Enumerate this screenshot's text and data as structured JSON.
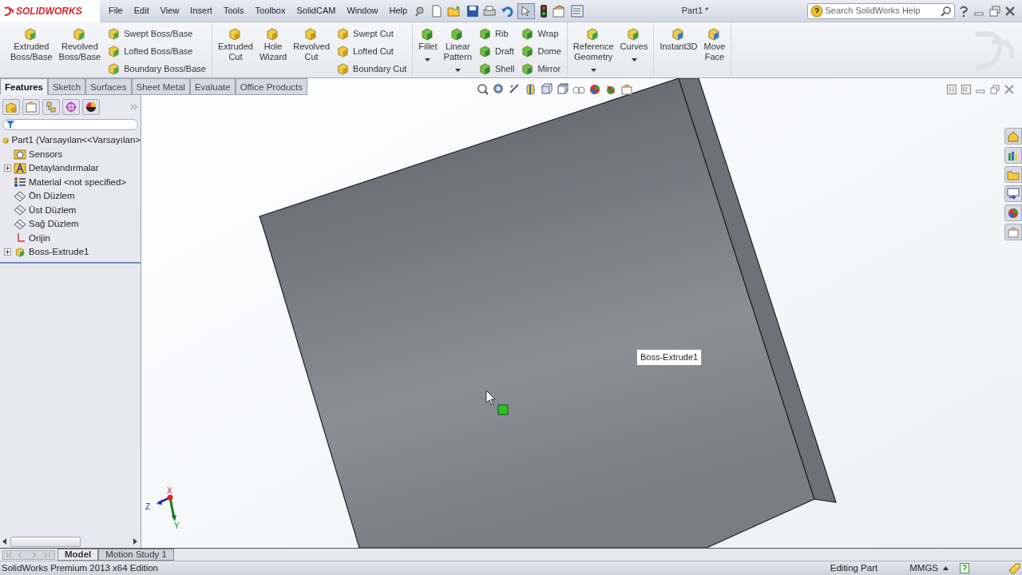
{
  "app": {
    "logo_text": "SOLIDWORKS"
  },
  "menu": [
    "File",
    "Edit",
    "View",
    "Insert",
    "Tools",
    "Toolbox",
    "SolidCAM",
    "Window",
    "Help"
  ],
  "document_title": "Part1 *",
  "search": {
    "placeholder": "Search SolidWorks Help"
  },
  "ribbon": {
    "groups": [
      {
        "columns": [
          {
            "kind": "large",
            "label": "Extruded\nBoss/Base",
            "dropdown": false
          },
          {
            "kind": "large",
            "label": "Revolved\nBoss/Base",
            "dropdown": false
          },
          {
            "kind": "stack",
            "items": [
              "Swept Boss/Base",
              "Lofted Boss/Base",
              "Boundary Boss/Base"
            ]
          }
        ]
      },
      {
        "columns": [
          {
            "kind": "large",
            "label": "Extruded\nCut",
            "dropdown": false
          },
          {
            "kind": "large",
            "label": "Hole\nWizard",
            "dropdown": false
          },
          {
            "kind": "large",
            "label": "Revolved\nCut",
            "dropdown": false
          },
          {
            "kind": "stack",
            "items": [
              "Swept Cut",
              "Lofted Cut",
              "Boundary Cut"
            ]
          }
        ]
      },
      {
        "columns": [
          {
            "kind": "large",
            "label": "Fillet",
            "dropdown": true
          },
          {
            "kind": "large",
            "label": "Linear\nPattern",
            "dropdown": true
          },
          {
            "kind": "stack",
            "items": [
              "Rib",
              "Draft",
              "Shell"
            ]
          },
          {
            "kind": "stack",
            "items": [
              "Wrap",
              "Dome",
              "Mirror"
            ]
          }
        ]
      },
      {
        "columns": [
          {
            "kind": "large",
            "label": "Reference\nGeometry",
            "dropdown": true
          },
          {
            "kind": "large",
            "label": "Curves",
            "dropdown": true
          }
        ]
      },
      {
        "columns": [
          {
            "kind": "large",
            "label": "Instant3D",
            "dropdown": false
          },
          {
            "kind": "large",
            "label": "Move\nFace",
            "dropdown": false
          }
        ]
      }
    ]
  },
  "tabs": [
    {
      "label": "Features",
      "selected": true
    },
    {
      "label": "Sketch",
      "selected": false
    },
    {
      "label": "Surfaces",
      "selected": false
    },
    {
      "label": "Sheet Metal",
      "selected": false
    },
    {
      "label": "Evaluate",
      "selected": false
    },
    {
      "label": "Office Products",
      "selected": false
    }
  ],
  "feature_tree": {
    "label": "Part1  (Varsayılan<<Varsayılan>",
    "kind": "part",
    "children": [
      {
        "label": "Sensors",
        "kind": "sensor",
        "expandable": false
      },
      {
        "label": "Detaylandırmalar",
        "kind": "annotation",
        "expandable": true
      },
      {
        "label": "Material <not specified>",
        "kind": "material",
        "expandable": false
      },
      {
        "label": "Ön Düzlem",
        "kind": "plane",
        "expandable": false
      },
      {
        "label": "Üst Düzlem",
        "kind": "plane",
        "expandable": false
      },
      {
        "label": "Sağ Düzlem",
        "kind": "plane",
        "expandable": false
      },
      {
        "label": "Orijin",
        "kind": "origin",
        "expandable": false
      },
      {
        "label": "Boss-Extrude1",
        "kind": "feature",
        "expandable": true
      }
    ]
  },
  "tooltip": "Boss-Extrude1",
  "triad": {
    "x": "X",
    "y": "Y",
    "z": "Z"
  },
  "bottom_tabs": [
    {
      "label": "Model",
      "selected": true
    },
    {
      "label": "Motion Study 1",
      "selected": false
    }
  ],
  "status_bar": {
    "edition": "SolidWorks Premium 2013 x64 Edition",
    "mode": "Editing Part",
    "units": "MMGS"
  }
}
